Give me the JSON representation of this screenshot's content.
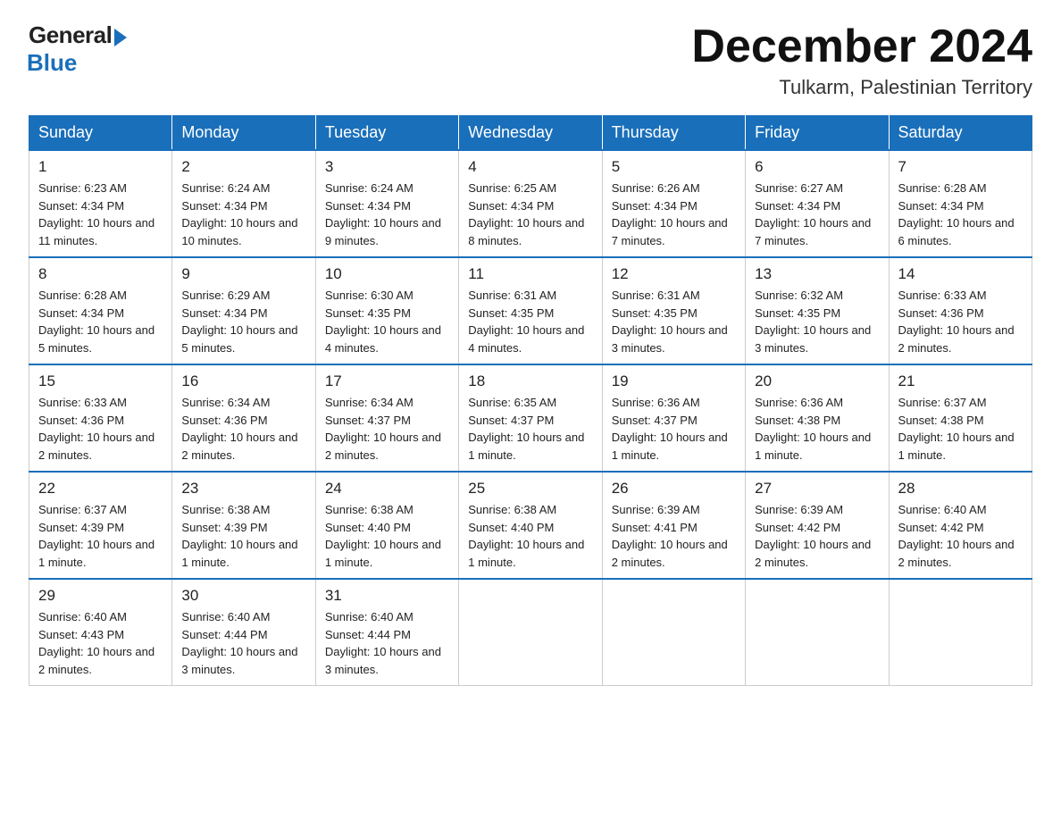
{
  "logo": {
    "general": "General",
    "blue": "Blue"
  },
  "title": "December 2024",
  "location": "Tulkarm, Palestinian Territory",
  "days_of_week": [
    "Sunday",
    "Monday",
    "Tuesday",
    "Wednesday",
    "Thursday",
    "Friday",
    "Saturday"
  ],
  "weeks": [
    [
      {
        "day": "1",
        "sunrise": "6:23 AM",
        "sunset": "4:34 PM",
        "daylight": "10 hours and 11 minutes."
      },
      {
        "day": "2",
        "sunrise": "6:24 AM",
        "sunset": "4:34 PM",
        "daylight": "10 hours and 10 minutes."
      },
      {
        "day": "3",
        "sunrise": "6:24 AM",
        "sunset": "4:34 PM",
        "daylight": "10 hours and 9 minutes."
      },
      {
        "day": "4",
        "sunrise": "6:25 AM",
        "sunset": "4:34 PM",
        "daylight": "10 hours and 8 minutes."
      },
      {
        "day": "5",
        "sunrise": "6:26 AM",
        "sunset": "4:34 PM",
        "daylight": "10 hours and 7 minutes."
      },
      {
        "day": "6",
        "sunrise": "6:27 AM",
        "sunset": "4:34 PM",
        "daylight": "10 hours and 7 minutes."
      },
      {
        "day": "7",
        "sunrise": "6:28 AM",
        "sunset": "4:34 PM",
        "daylight": "10 hours and 6 minutes."
      }
    ],
    [
      {
        "day": "8",
        "sunrise": "6:28 AM",
        "sunset": "4:34 PM",
        "daylight": "10 hours and 5 minutes."
      },
      {
        "day": "9",
        "sunrise": "6:29 AM",
        "sunset": "4:34 PM",
        "daylight": "10 hours and 5 minutes."
      },
      {
        "day": "10",
        "sunrise": "6:30 AM",
        "sunset": "4:35 PM",
        "daylight": "10 hours and 4 minutes."
      },
      {
        "day": "11",
        "sunrise": "6:31 AM",
        "sunset": "4:35 PM",
        "daylight": "10 hours and 4 minutes."
      },
      {
        "day": "12",
        "sunrise": "6:31 AM",
        "sunset": "4:35 PM",
        "daylight": "10 hours and 3 minutes."
      },
      {
        "day": "13",
        "sunrise": "6:32 AM",
        "sunset": "4:35 PM",
        "daylight": "10 hours and 3 minutes."
      },
      {
        "day": "14",
        "sunrise": "6:33 AM",
        "sunset": "4:36 PM",
        "daylight": "10 hours and 2 minutes."
      }
    ],
    [
      {
        "day": "15",
        "sunrise": "6:33 AM",
        "sunset": "4:36 PM",
        "daylight": "10 hours and 2 minutes."
      },
      {
        "day": "16",
        "sunrise": "6:34 AM",
        "sunset": "4:36 PM",
        "daylight": "10 hours and 2 minutes."
      },
      {
        "day": "17",
        "sunrise": "6:34 AM",
        "sunset": "4:37 PM",
        "daylight": "10 hours and 2 minutes."
      },
      {
        "day": "18",
        "sunrise": "6:35 AM",
        "sunset": "4:37 PM",
        "daylight": "10 hours and 1 minute."
      },
      {
        "day": "19",
        "sunrise": "6:36 AM",
        "sunset": "4:37 PM",
        "daylight": "10 hours and 1 minute."
      },
      {
        "day": "20",
        "sunrise": "6:36 AM",
        "sunset": "4:38 PM",
        "daylight": "10 hours and 1 minute."
      },
      {
        "day": "21",
        "sunrise": "6:37 AM",
        "sunset": "4:38 PM",
        "daylight": "10 hours and 1 minute."
      }
    ],
    [
      {
        "day": "22",
        "sunrise": "6:37 AM",
        "sunset": "4:39 PM",
        "daylight": "10 hours and 1 minute."
      },
      {
        "day": "23",
        "sunrise": "6:38 AM",
        "sunset": "4:39 PM",
        "daylight": "10 hours and 1 minute."
      },
      {
        "day": "24",
        "sunrise": "6:38 AM",
        "sunset": "4:40 PM",
        "daylight": "10 hours and 1 minute."
      },
      {
        "day": "25",
        "sunrise": "6:38 AM",
        "sunset": "4:40 PM",
        "daylight": "10 hours and 1 minute."
      },
      {
        "day": "26",
        "sunrise": "6:39 AM",
        "sunset": "4:41 PM",
        "daylight": "10 hours and 2 minutes."
      },
      {
        "day": "27",
        "sunrise": "6:39 AM",
        "sunset": "4:42 PM",
        "daylight": "10 hours and 2 minutes."
      },
      {
        "day": "28",
        "sunrise": "6:40 AM",
        "sunset": "4:42 PM",
        "daylight": "10 hours and 2 minutes."
      }
    ],
    [
      {
        "day": "29",
        "sunrise": "6:40 AM",
        "sunset": "4:43 PM",
        "daylight": "10 hours and 2 minutes."
      },
      {
        "day": "30",
        "sunrise": "6:40 AM",
        "sunset": "4:44 PM",
        "daylight": "10 hours and 3 minutes."
      },
      {
        "day": "31",
        "sunrise": "6:40 AM",
        "sunset": "4:44 PM",
        "daylight": "10 hours and 3 minutes."
      },
      null,
      null,
      null,
      null
    ]
  ]
}
